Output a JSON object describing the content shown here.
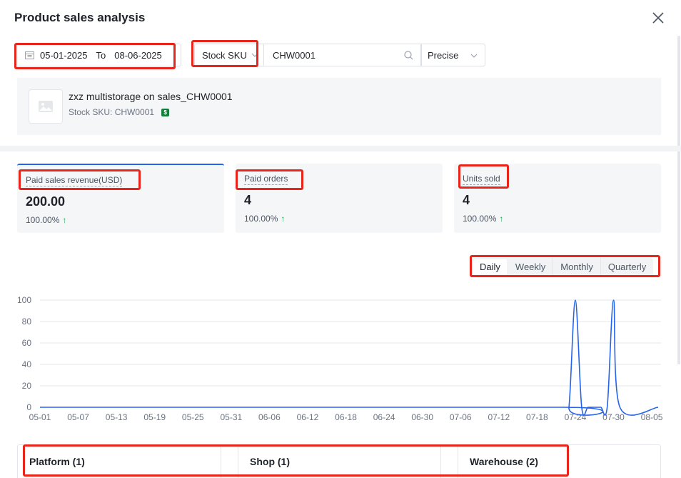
{
  "modal": {
    "title": "Product sales analysis"
  },
  "filters": {
    "date_start": "05-01-2025",
    "date_to_label": "To",
    "date_end": "08-06-2025",
    "sku_type": "Stock SKU",
    "sku_value": "CHW0001",
    "match_type": "Precise"
  },
  "product": {
    "name": "zxz multistorage on sales_CHW0001",
    "sku_label": "Stock SKU: CHW0001"
  },
  "metrics": [
    {
      "label": "Paid sales revenue(USD)",
      "value": "200.00",
      "change": "100.00%"
    },
    {
      "label": "Paid orders",
      "value": "4",
      "change": "100.00%"
    },
    {
      "label": "Units sold",
      "value": "4",
      "change": "100.00%"
    }
  ],
  "period_tabs": [
    "Daily",
    "Weekly",
    "Monthly",
    "Quarterly"
  ],
  "active_period": "Daily",
  "chart_data": {
    "type": "line",
    "x_ticks": [
      "05-01",
      "05-07",
      "05-13",
      "05-19",
      "05-25",
      "05-31",
      "06-06",
      "06-12",
      "06-18",
      "06-24",
      "06-30",
      "07-06",
      "07-12",
      "07-18",
      "07-24",
      "07-30",
      "08-05"
    ],
    "ylim": [
      0,
      100
    ],
    "y_ticks": [
      0,
      20,
      40,
      60,
      80,
      100
    ],
    "grid": true,
    "color": "#2563eb",
    "series": [
      {
        "x": [
          "05-01",
          "07-22",
          "07-23",
          "07-24",
          "07-25",
          "07-26",
          "07-27",
          "07-28",
          "07-29",
          "07-30",
          "07-31",
          "08-06"
        ],
        "values": [
          0,
          0,
          0,
          100,
          0,
          0,
          0,
          0,
          0,
          100,
          0,
          0
        ]
      }
    ]
  },
  "dimensions": [
    "Platform (1)",
    "Shop (1)",
    "Warehouse (2)"
  ],
  "colors": {
    "accent": "#2563eb",
    "up": "#16a34a",
    "highlight": "#e8251a"
  }
}
